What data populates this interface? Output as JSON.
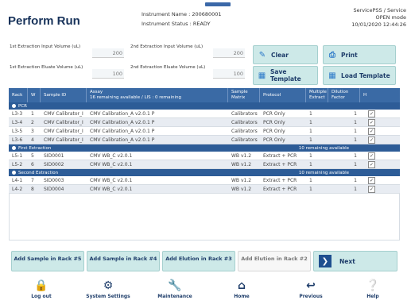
{
  "header": {
    "title": "Perform Run",
    "instrument_name": "Instrument Name : 200680001",
    "instrument_status": "Instrument Status : READY",
    "service_user": "ServicePSS / Service",
    "mode": "OPEN mode",
    "datetime": "10/01/2020 12:44:26"
  },
  "inputs": [
    {
      "label": "1st Extraction Input Volume (uL)",
      "value": "200"
    },
    {
      "label": "2nd Extraction Input Volume (uL)",
      "value": "200"
    },
    {
      "label": "1st Extraction Eluate Volume (uL)",
      "value": "100"
    },
    {
      "label": "2nd Extraction Eluate Volume (uL)",
      "value": "100"
    }
  ],
  "toolbar": {
    "clear": "Clear",
    "print": "Print",
    "save_template": "Save Template",
    "load_template": "Load Template"
  },
  "table": {
    "headers": {
      "rack": "Rack",
      "w": "W",
      "sample_id": "Sample ID",
      "assay": "Assay",
      "assay_sub": "16 remaining available / LIS : 0 remaining",
      "matrix": "Sample Matrix",
      "protocol": "Protocol",
      "multiple": "Multiple Extract",
      "dilution": "Dilution Factor",
      "h": "H"
    },
    "sections": [
      {
        "name": "PCR",
        "remaining": "",
        "rows": [
          {
            "rack": "L3-3",
            "w": "1",
            "sid": "CMV Calibrator_I",
            "assay": "CMV Calibration_A v2.0.1 P",
            "matrix": "Calibrators",
            "protocol": "PCR Only",
            "mult": "1",
            "dil": "1"
          },
          {
            "rack": "L3-4",
            "w": "2",
            "sid": "CMV Calibrator_I",
            "assay": "CMV Calibration_A v2.0.1 P",
            "matrix": "Calibrators",
            "protocol": "PCR Only",
            "mult": "1",
            "dil": "1"
          },
          {
            "rack": "L3-5",
            "w": "3",
            "sid": "CMV Calibrator_I",
            "assay": "CMV Calibration_A v2.0.1 P",
            "matrix": "Calibrators",
            "protocol": "PCR Only",
            "mult": "1",
            "dil": "1"
          },
          {
            "rack": "L3-6",
            "w": "4",
            "sid": "CMV Calibrator_I",
            "assay": "CMV Calibration_A v2.0.1 P",
            "matrix": "Calibrators",
            "protocol": "PCR Only",
            "mult": "1",
            "dil": "1"
          }
        ]
      },
      {
        "name": "First Extraction",
        "remaining": "10 remaining available",
        "rows": [
          {
            "rack": "L5-1",
            "w": "5",
            "sid": "SID0001",
            "assay": "CMV WB_C v2.0.1",
            "matrix": "WB v1.2",
            "protocol": "Extract + PCR",
            "mult": "1",
            "dil": "1"
          },
          {
            "rack": "L5-2",
            "w": "6",
            "sid": "SID0002",
            "assay": "CMV WB_C v2.0.1",
            "matrix": "WB v1.2",
            "protocol": "Extract + PCR",
            "mult": "1",
            "dil": "1"
          }
        ]
      },
      {
        "name": "Second Extraction",
        "remaining": "10 remaining available",
        "rows": [
          {
            "rack": "L4-1",
            "w": "7",
            "sid": "SID0003",
            "assay": "CMV WB_C v2.0.1",
            "matrix": "WB v1.2",
            "protocol": "Extract + PCR",
            "mult": "1",
            "dil": "1"
          },
          {
            "rack": "L4-2",
            "w": "8",
            "sid": "SID0004",
            "assay": "CMV WB_C v2.0.1",
            "matrix": "WB v1.2",
            "protocol": "Extract + PCR",
            "mult": "1",
            "dil": "1"
          }
        ]
      }
    ]
  },
  "actions": {
    "add1": "Add Sample in Rack #5",
    "add2": "Add Sample in Rack #4",
    "add3": "Add Elution in Rack #3",
    "add4": "Add Elution in Rack #2",
    "next": "Next"
  },
  "nav": {
    "logout": "Log out",
    "system_settings": "System Settings",
    "maintenance": "Maintenance",
    "home": "Home",
    "previous": "Previous",
    "help": "Help"
  },
  "colors": {
    "header_bar": "#3a6aa5",
    "section_bar": "#2d5c97",
    "button_bg": "#cde9e8",
    "title": "#17325a"
  }
}
